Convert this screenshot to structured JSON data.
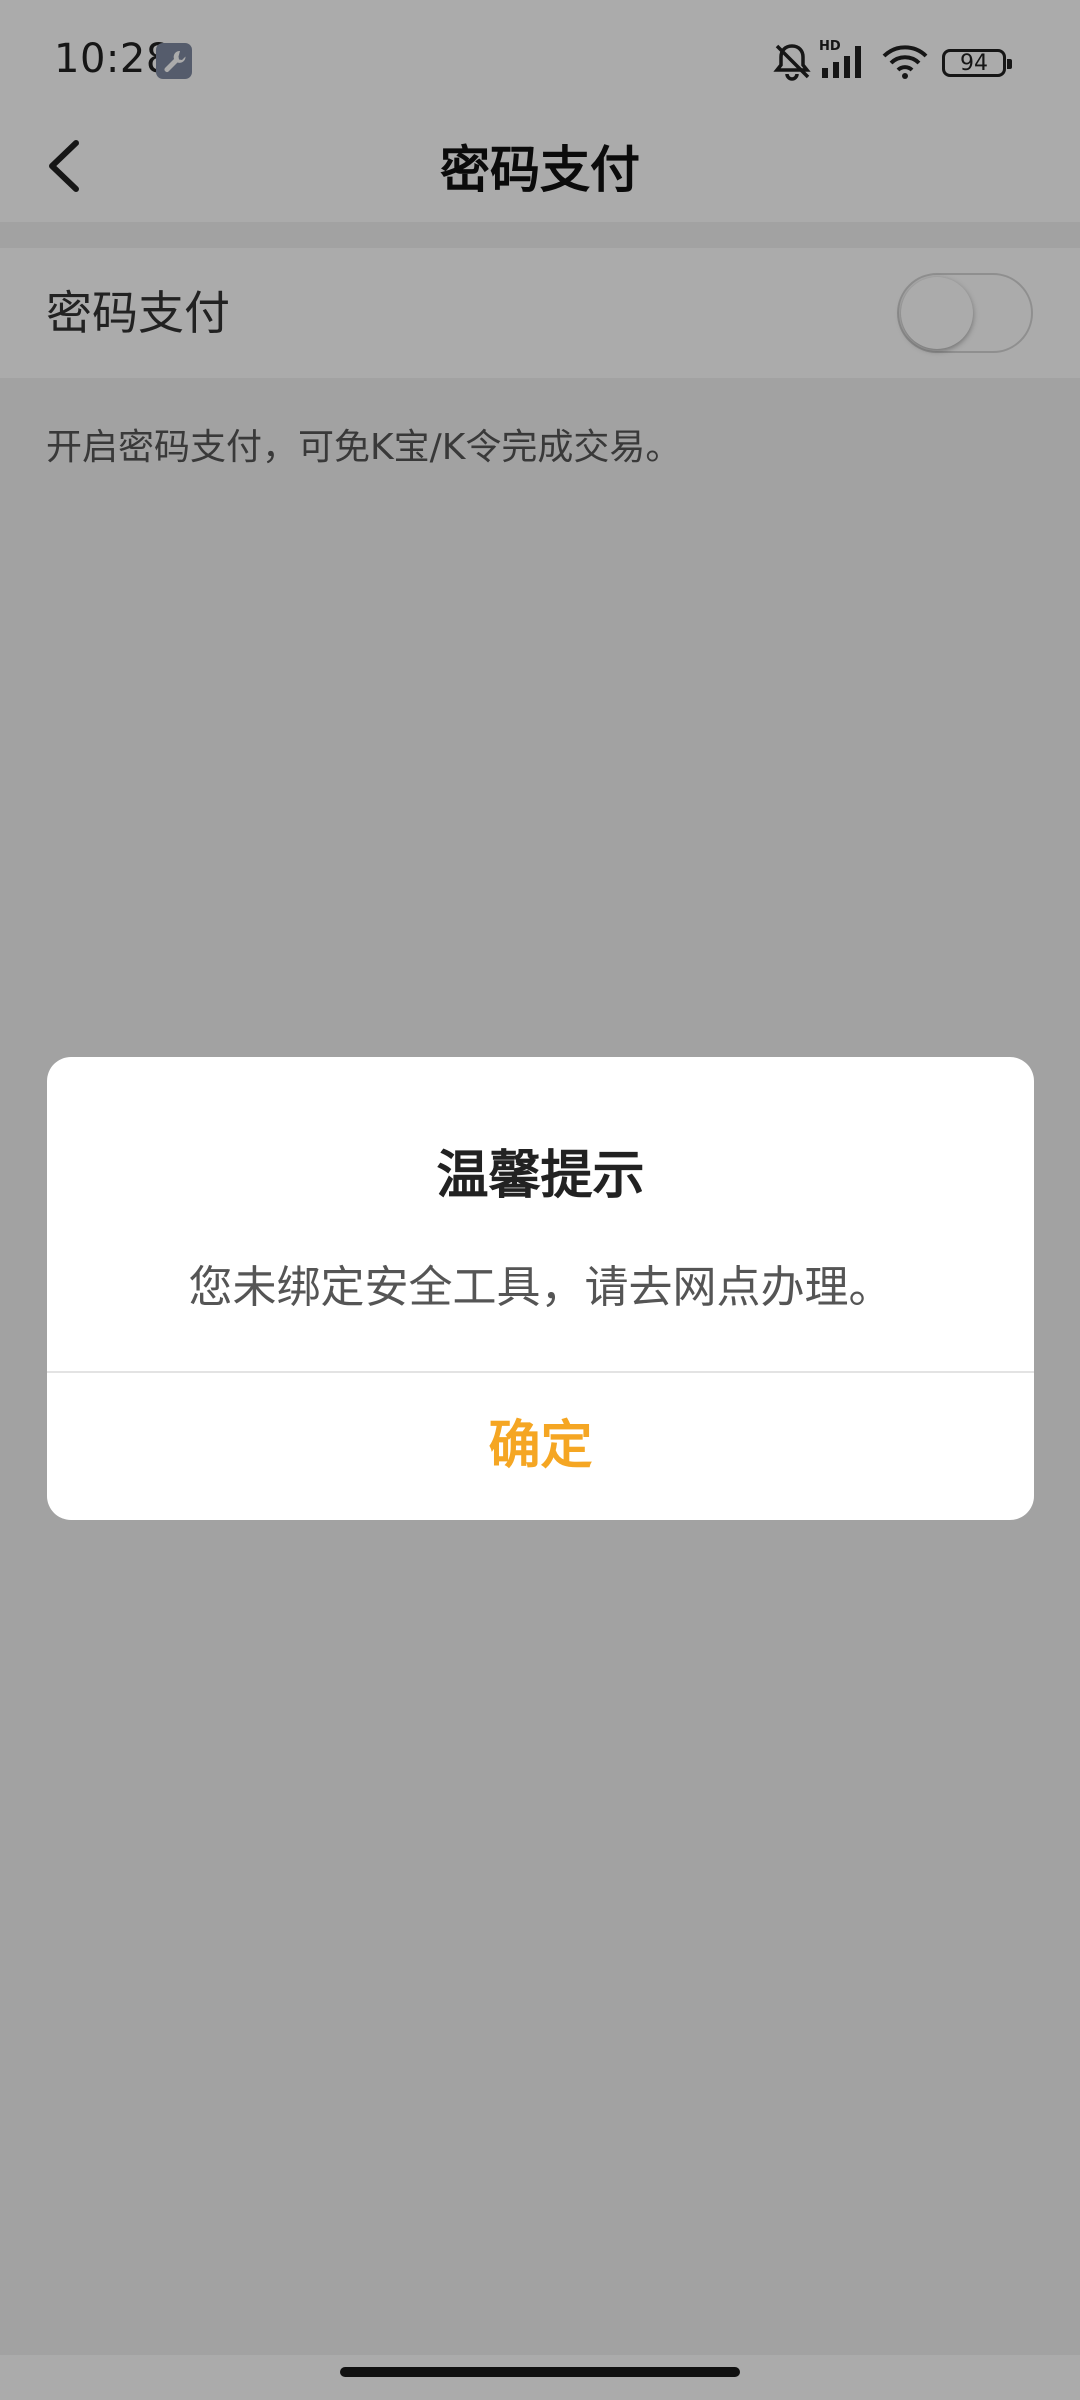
{
  "status_bar": {
    "time": "10:28",
    "battery": "94",
    "icons": [
      "wrench-icon",
      "bell-off-icon",
      "hd-signal-icon",
      "wifi-icon",
      "battery-icon"
    ]
  },
  "nav": {
    "title": "密码支付",
    "back_icon": "chevron-left-icon"
  },
  "setting": {
    "label": "密码支付",
    "enabled": false,
    "description": "开启密码支付，可免K宝/K令完成交易。"
  },
  "dialog": {
    "title": "温馨提示",
    "message": "您未绑定安全工具，请去网点办理。",
    "confirm_label": "确定"
  },
  "colors": {
    "accent": "#f5a623",
    "overlay": "rgba(0,0,0,0.33)"
  }
}
